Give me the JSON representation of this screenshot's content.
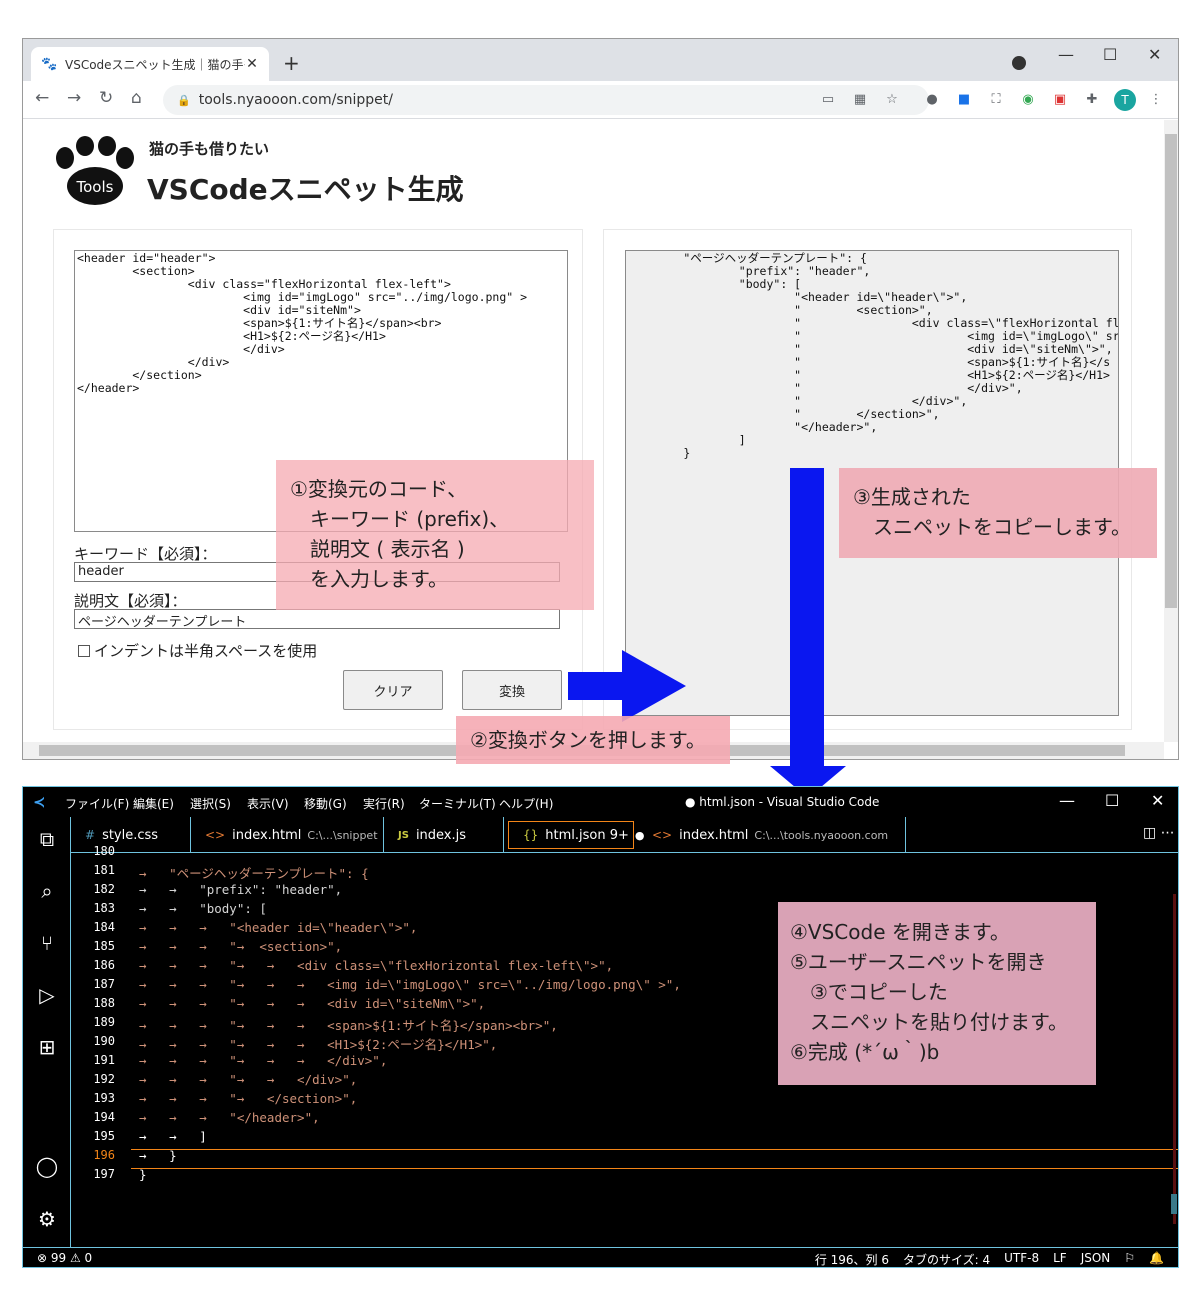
{
  "browser": {
    "tab_title": "VSCodeスニペット生成｜猫の手も借",
    "tab_close": "✕",
    "new_tab": "+",
    "url": "tools.nyaooon.com/snippet/",
    "avatar_letter": "T",
    "win_controls": [
      "—",
      "☐",
      "✕"
    ]
  },
  "page": {
    "site_subtitle": "猫の手も借りたい",
    "site_title": "VSCodeスニペット生成",
    "logo_text": "Tools",
    "source_code": "<header id=\"header\">\n        <section>\n                <div class=\"flexHorizontal flex-left\">\n                        <img id=\"imgLogo\" src=\"../img/logo.png\" >\n                        <div id=\"siteNm\">\n                        <span>${1:サイト名}</span><br>\n                        <H1>${2:ページ名}</H1>\n                        </div>\n                </div>\n        </section>\n</header>",
    "keyword_label": "キーワード【必須】：",
    "keyword_value": "header",
    "desc_label": "説明文【必須】：",
    "desc_value": "ページヘッダーテンプレート",
    "indent_label": "インデントは半角スペースを使用",
    "clear_button": "クリア",
    "convert_button": "変換",
    "output_code": "        \"ページヘッダーテンプレート\": {\n                \"prefix\": \"header\",\n                \"body\": [\n                        \"<header id=\\\"header\\\">\",\n                        \"        <section>\",\n                        \"                <div class=\\\"flexHorizontal fl\n                        \"                        <img id=\\\"imgLogo\\\" sr\n                        \"                        <div id=\\\"siteNm\\\">\",\n                        \"                        <span>${1:サイト名}</s\n                        \"                        <H1>${2:ページ名}</H1>\n                        \"                        </div>\",\n                        \"                </div>\",\n                        \"        </section>\",\n                        \"</header>\",\n                ]\n        }"
  },
  "callouts": {
    "step1": "①変換元のコード、\n　キーワード (prefix)、\n　説明文 ( 表示名 )\n　を入力します。",
    "step2": "②変換ボタンを押します。",
    "step3": "③生成された\n　スニペットをコピーします。",
    "step4": "④VSCode を開きます。\n⑤ユーザースニペットを開き\n　③でコピーした\n　スニペットを貼り付けます。\n⑥完成 (*´ω｀)b"
  },
  "vscode": {
    "menus": [
      "ファイル(F)",
      "編集(E)",
      "選択(S)",
      "表示(V)",
      "移動(G)",
      "実行(R)",
      "ターミナル(T)",
      "ヘルプ(H)"
    ],
    "title": "● html.json - Visual Studio Code",
    "tabs": [
      {
        "icon": "#",
        "name": "style.css",
        "path": ""
      },
      {
        "icon": "<>",
        "name": "index.html",
        "path": "C:\\...\\snippet"
      },
      {
        "icon": "JS",
        "name": "index.js",
        "path": ""
      },
      {
        "icon": "{}",
        "name": "html.json 9+",
        "path": "●"
      },
      {
        "icon": "<>",
        "name": "index.html",
        "path": "C:\\...\\tools.nyaooon.com"
      }
    ],
    "line_numbers": [
      "180",
      "181",
      "182",
      "183",
      "184",
      "185",
      "186",
      "187",
      "188",
      "189",
      "190",
      "191",
      "192",
      "193",
      "194",
      "195",
      "196",
      "197"
    ],
    "lines": [
      "",
      "→   \"ページヘッダーテンプレート\": {",
      "→   →   \"prefix\": \"header\",",
      "→   →   \"body\": [",
      "→   →   →   \"<header id=\\\"header\\\">\",",
      "→   →   →   \"→  <section>\",",
      "→   →   →   \"→   →   <div class=\\\"flexHorizontal flex-left\\\">\",",
      "→   →   →   \"→   →   →   <img id=\\\"imgLogo\\\" src=\\\"../img/logo.png\\\" >\",",
      "→   →   →   \"→   →   →   <div id=\\\"siteNm\\\">\",",
      "→   →   →   \"→   →   →   <span>${1:サイト名}</span><br>\",",
      "→   →   →   \"→   →   →   <H1>${2:ページ名}</H1>\",",
      "→   →   →   \"→   →   →   </div>\",",
      "→   →   →   \"→   →   </div>\",",
      "→   →   →   \"→   </section>\",",
      "→   →   →   \"</header>\",",
      "→   →   ]",
      "→   }",
      "}"
    ],
    "status_left": "⊗ 99 ⚠ 0",
    "status_right": [
      "行 196、列 6",
      "タブのサイズ: 4",
      "UTF-8",
      "LF",
      "JSON"
    ]
  }
}
